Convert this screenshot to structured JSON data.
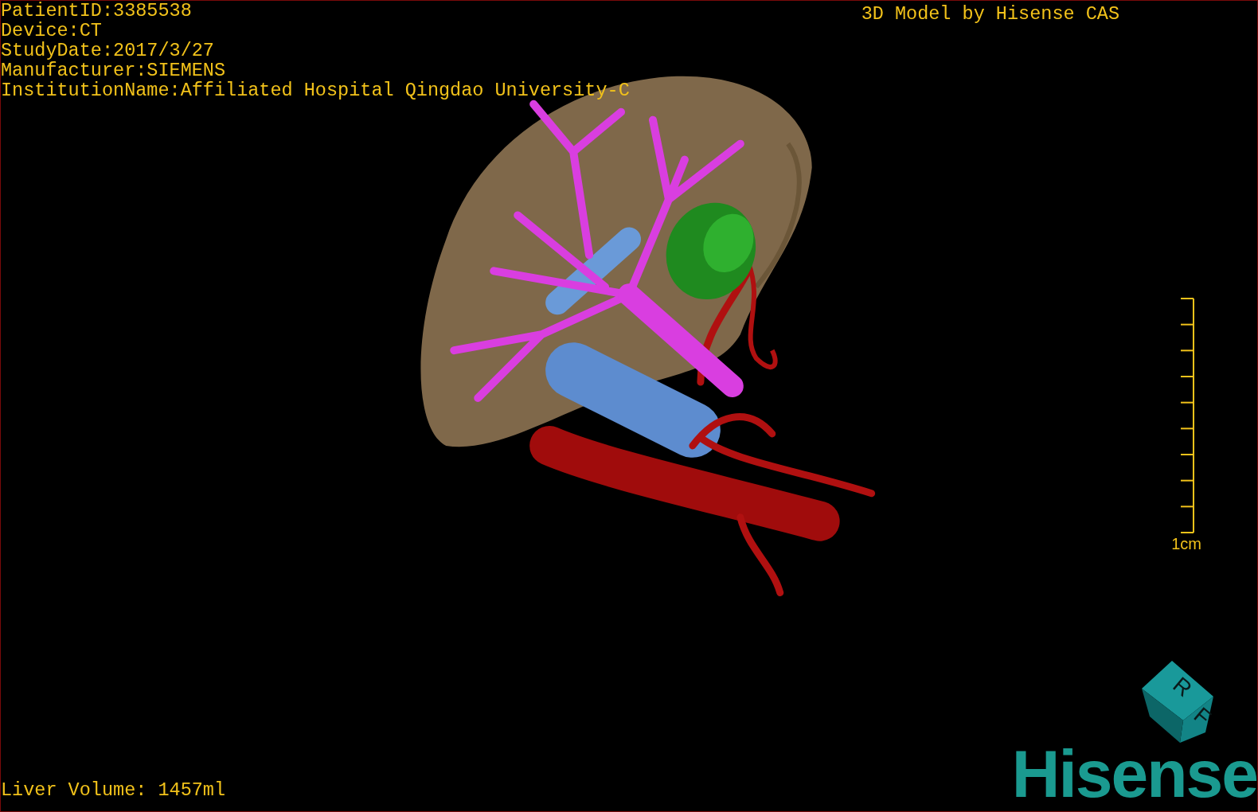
{
  "patient_info": [
    "PatientID:3385538",
    "Device:CT",
    "StudyDate:2017/3/27",
    "Manufacturer:SIEMENS",
    "InstitutionName:Affiliated Hospital Qingdao University-C"
  ],
  "title": "3D Model by Hisense CAS",
  "scale_bar": {
    "label": "1cm"
  },
  "orientation_cube": {
    "faces": [
      "R",
      "F"
    ]
  },
  "liver_volume": "Liver Volume: 1457ml",
  "logo": "Hisense"
}
